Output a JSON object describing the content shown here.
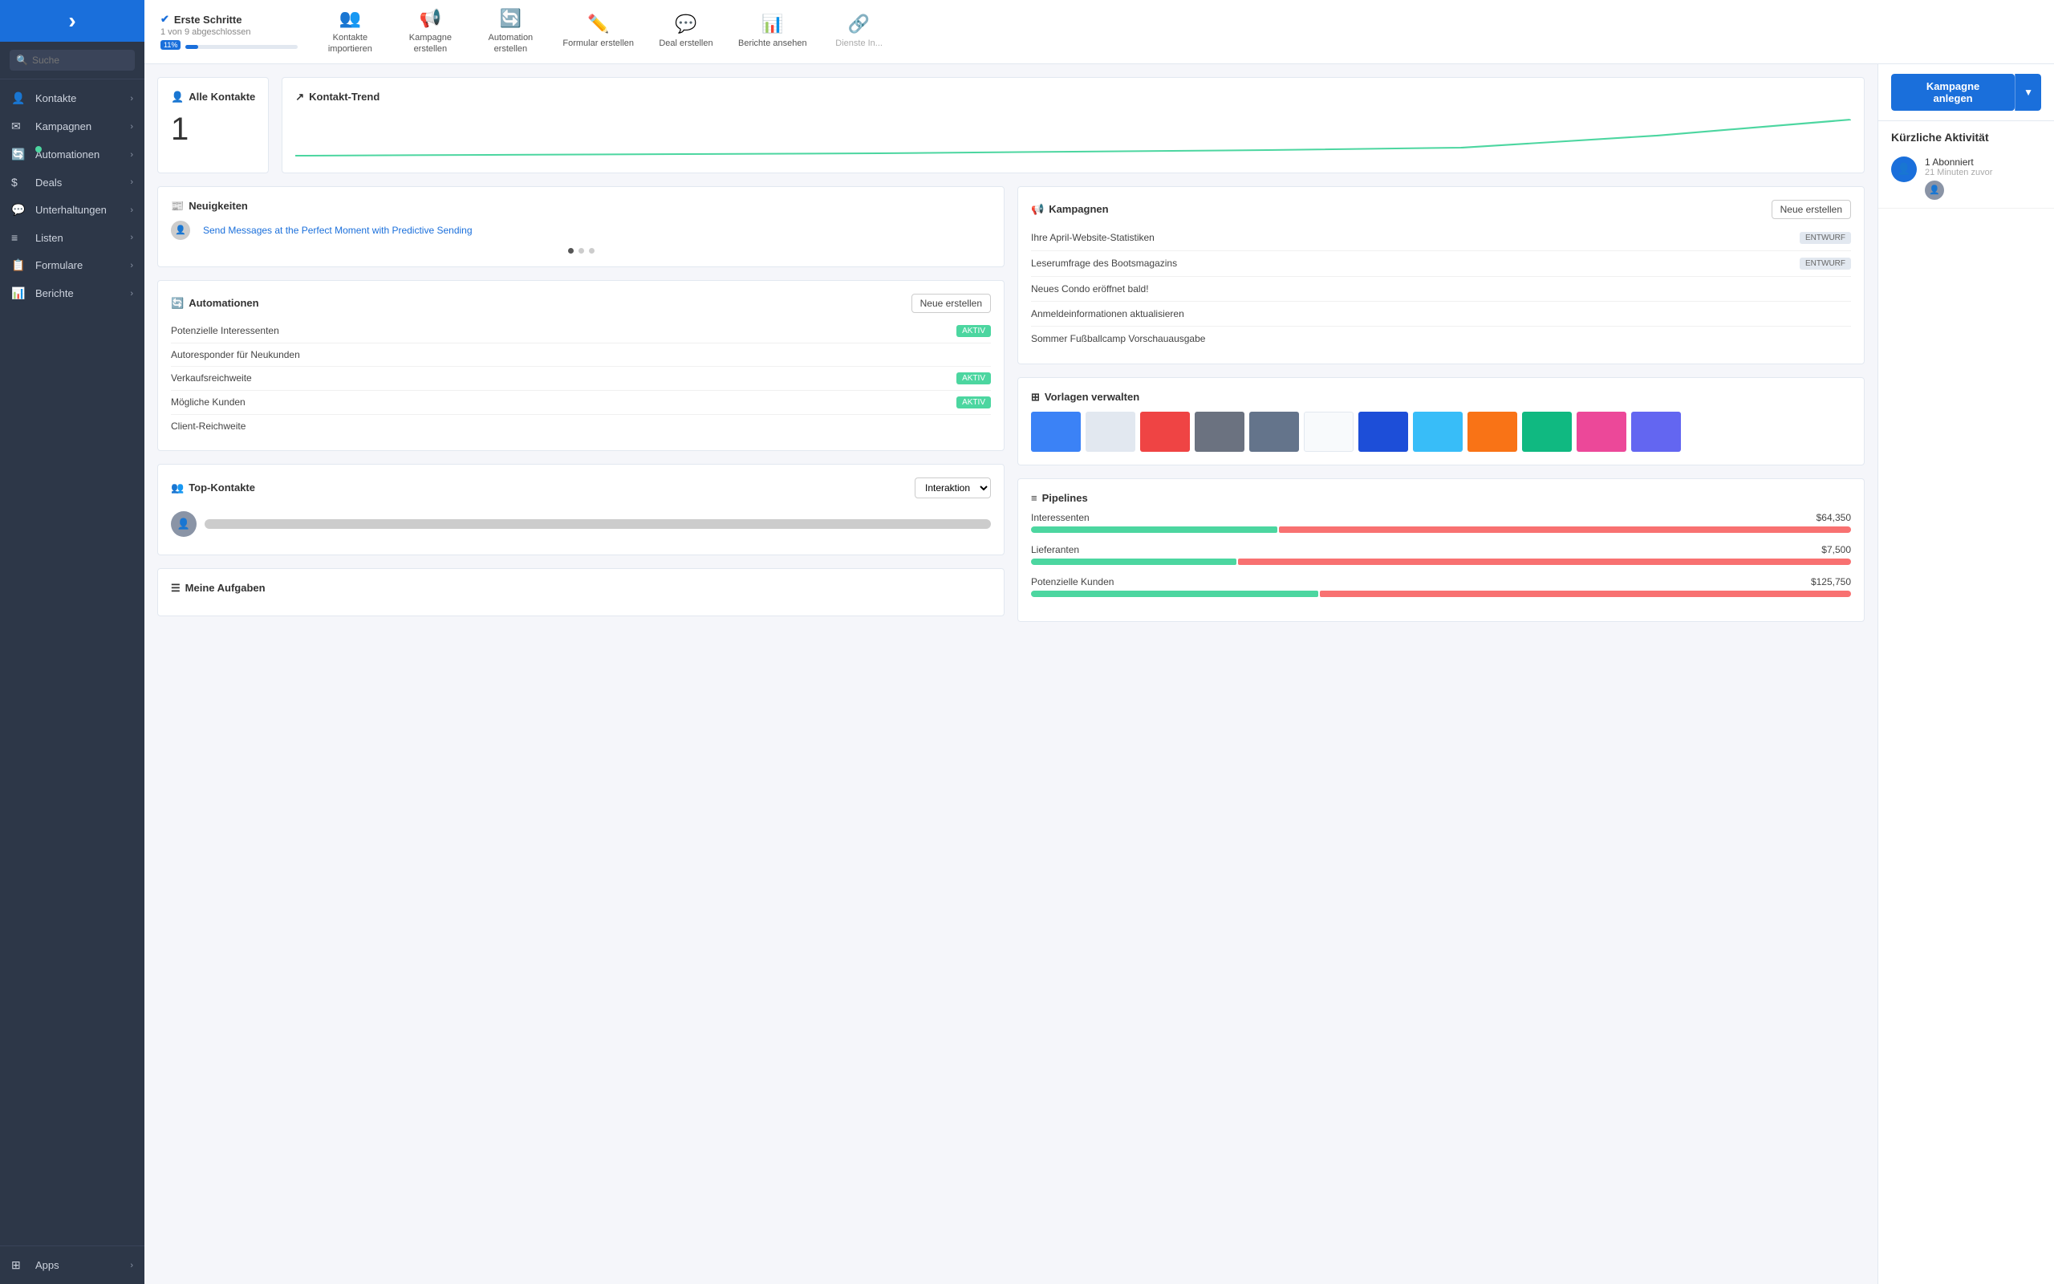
{
  "sidebar": {
    "logo_icon": "›",
    "search_placeholder": "Suche",
    "items": [
      {
        "id": "kontakte",
        "label": "Kontakte",
        "icon": "👤",
        "has_arrow": true,
        "has_dot": false
      },
      {
        "id": "kampagnen",
        "label": "Kampagnen",
        "icon": "✉",
        "has_arrow": true,
        "has_dot": false
      },
      {
        "id": "automationen",
        "label": "Automationen",
        "icon": "🔄",
        "has_arrow": true,
        "has_dot": true
      },
      {
        "id": "deals",
        "label": "Deals",
        "icon": "$",
        "has_arrow": true,
        "has_dot": false
      },
      {
        "id": "unterhaltungen",
        "label": "Unterhaltungen",
        "icon": "💬",
        "has_arrow": true,
        "has_dot": false
      },
      {
        "id": "listen",
        "label": "Listen",
        "icon": "≡",
        "has_arrow": true,
        "has_dot": false
      },
      {
        "id": "formulare",
        "label": "Formulare",
        "icon": "📋",
        "has_arrow": true,
        "has_dot": false
      },
      {
        "id": "berichte",
        "label": "Berichte",
        "icon": "📊",
        "has_arrow": true,
        "has_dot": false
      }
    ],
    "bottom_items": [
      {
        "id": "apps",
        "label": "Apps",
        "icon": "⊞",
        "has_arrow": true
      }
    ]
  },
  "topbar": {
    "getting_started_title": "Erste Schritte",
    "getting_started_subtitle": "1 von 9 abgeschlossen",
    "progress_badge": "11%",
    "steps": [
      {
        "id": "kontakte-importieren",
        "icon": "👥",
        "label": "Kontakte\nimportieren"
      },
      {
        "id": "kampagne-erstellen",
        "icon": "📢",
        "label": "Kampagne\nerstellen"
      },
      {
        "id": "automation-erstellen",
        "icon": "🔄",
        "label": "Automation\nerstellen"
      },
      {
        "id": "formular-erstellen",
        "icon": "✏️",
        "label": "Formular erstellen"
      },
      {
        "id": "deal-erstellen",
        "icon": "💬",
        "label": "Deal erstellen"
      },
      {
        "id": "berichte-ansehen",
        "icon": "📊",
        "label": "Berichte ansehen"
      },
      {
        "id": "dienste-in",
        "icon": "🔗",
        "label": "Dienste In..."
      }
    ]
  },
  "alle_kontakte": {
    "title": "Alle Kontakte",
    "count": "1"
  },
  "kontakt_trend": {
    "title": "Kontakt-Trend"
  },
  "neuigkeiten": {
    "title": "Neuigkeiten",
    "link_text": "Send Messages at the Perfect Moment with Predictive Sending",
    "dots": [
      true,
      false,
      false
    ]
  },
  "automationen": {
    "title": "Automationen",
    "btn_label": "Neue erstellen",
    "items": [
      {
        "name": "Potenzielle Interessenten",
        "badge": "AKTIV"
      },
      {
        "name": "Autoresponder für Neukunden",
        "badge": null
      },
      {
        "name": "Verkaufsreichweite",
        "badge": "AKTIV"
      },
      {
        "name": "Mögliche Kunden",
        "badge": "AKTIV"
      },
      {
        "name": "Client-Reichweite",
        "badge": null
      }
    ]
  },
  "kampagnen": {
    "title": "Kampagnen",
    "btn_label": "Neue erstellen",
    "items": [
      {
        "name": "Ihre April-Website-Statistiken",
        "badge": "ENTWURF"
      },
      {
        "name": "Leserumfrage des Bootsmagazins",
        "badge": "ENTWURF"
      },
      {
        "name": "Neues Condo eröffnet bald!",
        "badge": null
      },
      {
        "name": "Anmeldeinformationen aktualisieren",
        "badge": null
      },
      {
        "name": "Sommer Fußballcamp Vorschauausgabe",
        "badge": null
      }
    ]
  },
  "top_kontakte": {
    "title": "Top-Kontakte",
    "filter_label": "Interaktion",
    "contact_placeholder": "████████████████████████"
  },
  "vorlagen": {
    "title": "Vorlagen verwalten",
    "colors": [
      "#3b82f6",
      "#e2e8f0",
      "#ef4444",
      "#8b5cf6",
      "#64748b",
      "#f8fafc",
      "#1d4ed8",
      "#38bdf8",
      "#f97316",
      "#10b981",
      "#ec4899",
      "#6366f1"
    ]
  },
  "pipelines": {
    "title": "Pipelines",
    "items": [
      {
        "name": "Interessenten",
        "amount": "$64,350",
        "green_pct": 30,
        "red_pct": 70
      },
      {
        "name": "Lieferanten",
        "amount": "$7,500",
        "green_pct": 25,
        "red_pct": 75
      },
      {
        "name": "Potenzielle Kunden",
        "amount": "$125,750",
        "green_pct": 35,
        "red_pct": 65
      }
    ]
  },
  "meine_aufgaben": {
    "title": "Meine Aufgaben"
  },
  "right_panel": {
    "create_btn_label": "Kampagne anlegen",
    "dropdown_icon": "▼",
    "activity_title": "Kürzliche Aktivität",
    "activity_items": [
      {
        "icon": "👤",
        "text": "1 Abonniert",
        "time": "21 Minuten zuvor"
      }
    ]
  }
}
